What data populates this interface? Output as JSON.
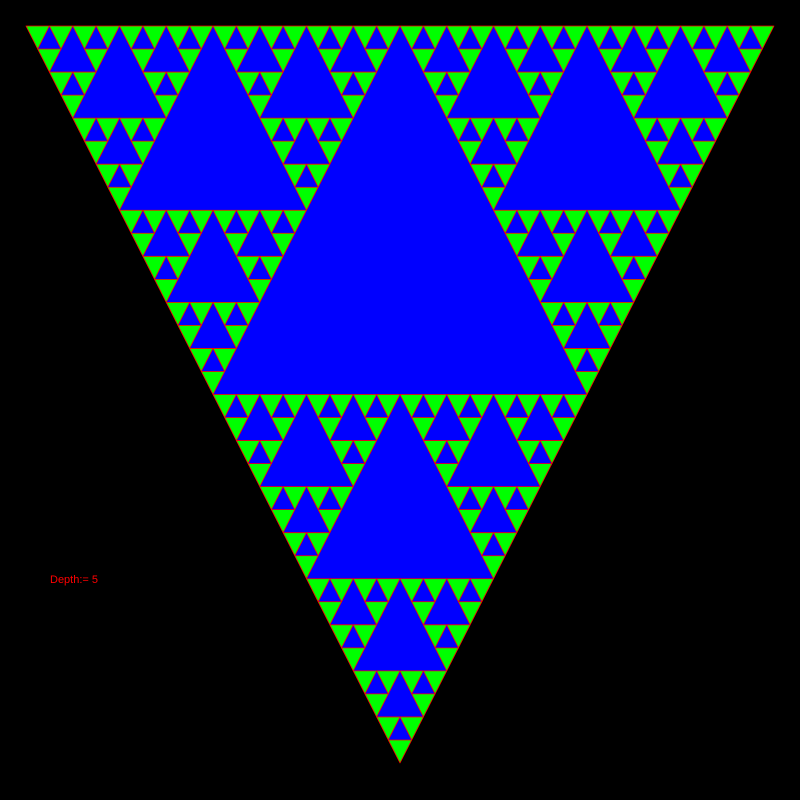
{
  "fractal": {
    "name": "sierpinski-triangle",
    "depth": 5,
    "depth_label": "Depth:= 5"
  },
  "colors": {
    "background": "#000000",
    "fill_outer": "#00ff00",
    "fill_inner": "#0000ff",
    "edge": "#ff0000",
    "label": "#ff0000"
  }
}
